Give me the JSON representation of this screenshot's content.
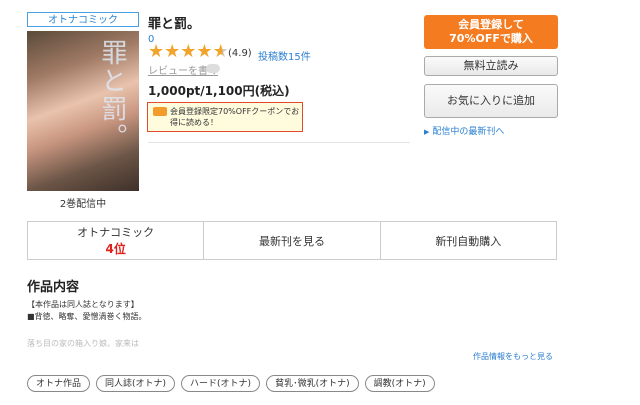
{
  "category_badge": "オトナコミック",
  "cover": {
    "overlay_text": "罪と罰。"
  },
  "volumes_text": "2巻配信中",
  "title": "罪と罰。",
  "author": "0",
  "rating": {
    "stars": 4.5,
    "max": 5,
    "score_text": "(4.9)",
    "reviews_text": "投稿数15件"
  },
  "write_review": "レビューを書く",
  "price": "1,000pt/1,100円(税込)",
  "coupon": {
    "text": "会員登録限定70%OFFクーポンでお得に読める！"
  },
  "buttons": {
    "register_line1": "会員登録して",
    "register_line2": "70%OFFで購入",
    "free_trial": "無料立読み",
    "favorite": "お気に入りに追加",
    "latest_link": "配信中の最新刊へ"
  },
  "tabs": [
    {
      "label": "オトナコミック",
      "sub": "4位"
    },
    {
      "label": "最新刊を見る"
    },
    {
      "label": "新刊自動購入"
    }
  ],
  "section_title": "作品内容",
  "description": [
    "【本作品は同人誌となります】",
    "■背徳、略奪、愛憎渦巻く物語。"
  ],
  "description_faded": "落ち目の家の箱入り娘、家来は",
  "more_info": "作品情報をもっと見る",
  "tags": [
    "オトナ作品",
    "同人誌(オトナ)",
    "ハード(オトナ)",
    "貧乳･微乳(オトナ)",
    "調教(オトナ)"
  ],
  "colors": {
    "accent": "#f47b20",
    "link": "#2a7fd0",
    "star": "#f2a32b",
    "rank": "#e0201b"
  }
}
